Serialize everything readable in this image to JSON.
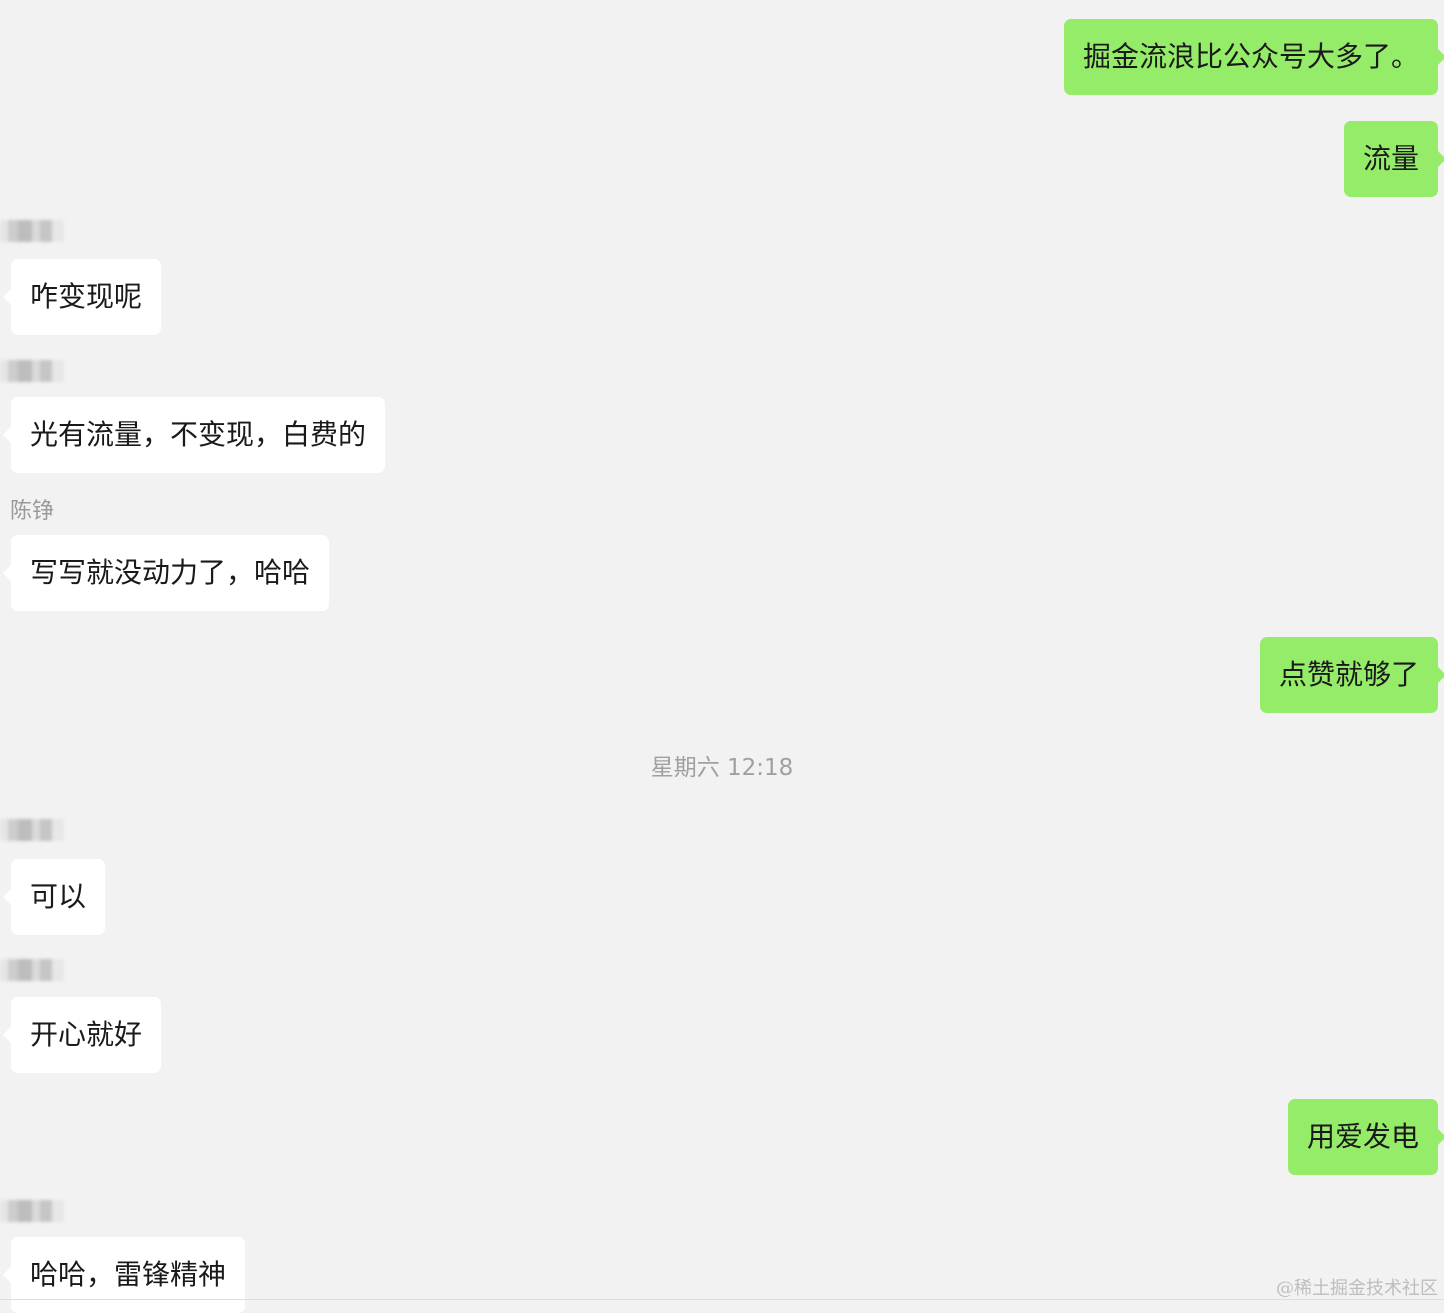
{
  "messages": [
    {
      "side": "self",
      "text": "掘金流浪比公众号大多了。"
    },
    {
      "side": "self",
      "text": "流量"
    },
    {
      "side": "other",
      "sender_blurred": true,
      "text": "咋变现呢"
    },
    {
      "side": "other",
      "sender_blurred": true,
      "text": "光有流量，不变现，白费的"
    },
    {
      "side": "other",
      "sender": "陈铮",
      "text": "写写就没动力了，哈哈"
    },
    {
      "side": "self",
      "text": "点赞就够了"
    },
    {
      "side": "other",
      "sender_blurred": true,
      "text": "可以"
    },
    {
      "side": "other",
      "sender_blurred": true,
      "text": "开心就好"
    },
    {
      "side": "self",
      "text": "用爱发电"
    },
    {
      "side": "other",
      "sender_blurred": true,
      "text": "哈哈，雷锋精神"
    }
  ],
  "timestamp": "星期六 12:18",
  "watermark": "@稀土掘金技术社区",
  "colors": {
    "background": "#f2f2f2",
    "self_bubble": "#95ec69",
    "other_bubble": "#ffffff",
    "meta_text": "#9a9a9a"
  }
}
